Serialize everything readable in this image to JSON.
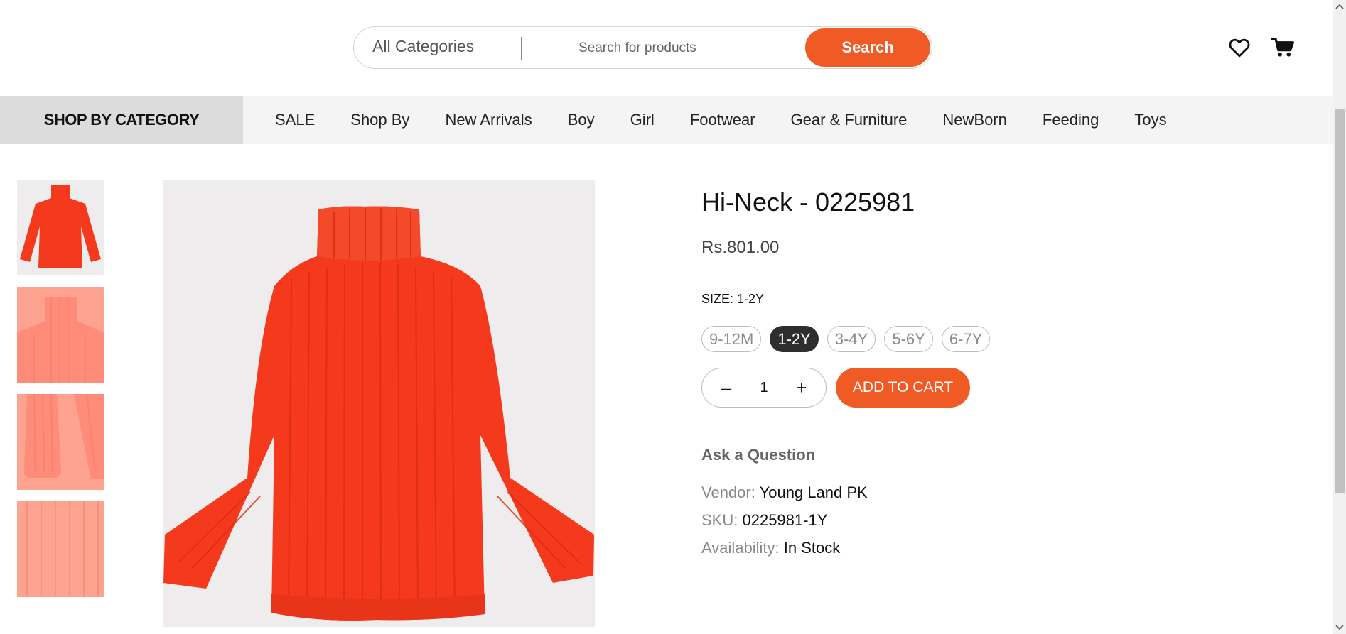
{
  "header": {
    "category_select": "All Categories",
    "search_placeholder": "Search for products",
    "search_button": "Search",
    "icons": [
      "heart-icon",
      "cart-icon"
    ]
  },
  "nav": {
    "shop_by_category": "SHOP BY CATEGORY",
    "items": [
      "SALE",
      "Shop By",
      "New Arrivals",
      "Boy",
      "Girl",
      "Footwear",
      "Gear & Furniture",
      "NewBorn",
      "Feeding",
      "Toys"
    ]
  },
  "product": {
    "title": "Hi-Neck - 0225981",
    "price": "Rs.801.00",
    "size_label": "SIZE:",
    "size_selected": "1-2Y",
    "sizes": [
      "9-12M",
      "1-2Y",
      "3-4Y",
      "5-6Y",
      "6-7Y"
    ],
    "quantity": "1",
    "qty_minus": "–",
    "qty_plus": "+",
    "add_to_cart": "ADD TO CART",
    "ask_question": "Ask a Question",
    "vendor_label": "Vendor:",
    "vendor": "Young Land PK",
    "sku_label": "SKU:",
    "sku": "0225981-1Y",
    "availability_label": "Availability:",
    "availability": "In Stock"
  },
  "colors": {
    "accent": "#f05a24",
    "garment": "#f5391c",
    "selected_chip": "#2e2e2e"
  }
}
